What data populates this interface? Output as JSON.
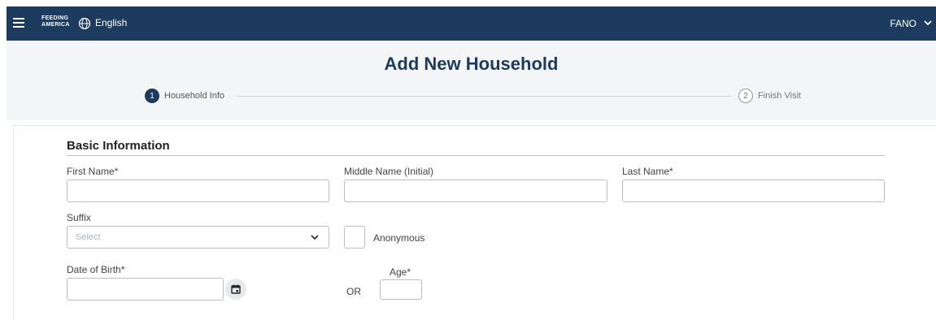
{
  "topbar": {
    "brand_line1": "FEEDING",
    "brand_line2": "AMERICA",
    "language": "English",
    "user": "FANO"
  },
  "page": {
    "title": "Add New Household"
  },
  "stepper": {
    "steps": [
      {
        "number": "1",
        "label": "Household Info"
      },
      {
        "number": "2",
        "label": "Finish Visit"
      }
    ]
  },
  "form": {
    "section_title": "Basic Information",
    "first_name_label": "First Name*",
    "middle_name_label": "Middle Name (Initial)",
    "last_name_label": "Last Name*",
    "suffix_label": "Suffix",
    "suffix_placeholder": "Select",
    "anonymous_label": "Anonymous",
    "dob_label": "Date of Birth*",
    "or_label": "OR",
    "age_label": "Age*"
  },
  "colors": {
    "navbar": "#1d3b5f",
    "title": "#1d3b5f",
    "header_bg": "#f4f5f6"
  }
}
